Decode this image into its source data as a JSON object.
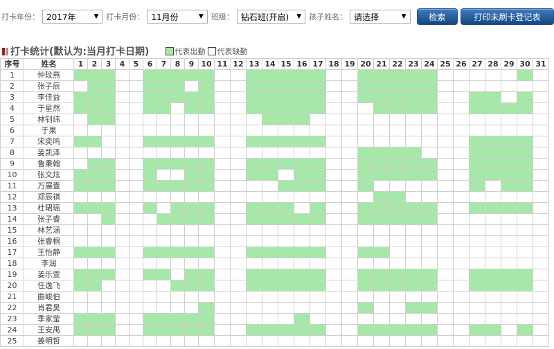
{
  "filters": {
    "year_label": "打卡年份：",
    "year_value": "2017年",
    "month_label": "打卡月份：",
    "month_value": "11月份",
    "class_label": "班级：",
    "class_value": "钻石班(开启)",
    "child_label": "孩子姓名：",
    "child_value": "请选择",
    "search_button": "检索",
    "print_button": "打印未刷卡登记表"
  },
  "section": {
    "title": "打卡统计(默认为:当月打卡日期)",
    "legend_present": "代表出勤",
    "legend_absent": "代表缺勤"
  },
  "colors": {
    "present": "#a5e8a7",
    "button": "#1f5b9f",
    "marker": "#a31b1b"
  },
  "table": {
    "col_index": "序号",
    "col_name": "姓名",
    "days": [
      "1",
      "2",
      "3",
      "4",
      "5",
      "6",
      "7",
      "8",
      "9",
      "10",
      "11",
      "12",
      "13",
      "14",
      "15",
      "16",
      "17",
      "18",
      "19",
      "20",
      "21",
      "22",
      "23",
      "24",
      "25",
      "26",
      "27",
      "28",
      "29",
      "30",
      "31"
    ],
    "rows": [
      {
        "no": "1",
        "name": "仲玟燕",
        "present": [
          1,
          2,
          3,
          6,
          7,
          8,
          9,
          10,
          13,
          14,
          15,
          16,
          17,
          20,
          21,
          22,
          23,
          24,
          30
        ]
      },
      {
        "no": "2",
        "name": "张子辰",
        "present": [
          2,
          3,
          6,
          7,
          8,
          10,
          13,
          14,
          15,
          16,
          17,
          20,
          21,
          22,
          23,
          24
        ]
      },
      {
        "no": "3",
        "name": "李佳益",
        "present": [
          1,
          2,
          3,
          6,
          7,
          8,
          9,
          10,
          13,
          14,
          15,
          16,
          17,
          20,
          21,
          22,
          23,
          24,
          27,
          28,
          30
        ]
      },
      {
        "no": "4",
        "name": "于星然",
        "present": [
          1,
          2,
          3,
          6,
          7,
          9,
          10,
          13,
          14,
          15,
          16,
          17,
          21,
          22,
          23,
          24,
          27,
          28,
          29,
          30
        ]
      },
      {
        "no": "5",
        "name": "林钊纬",
        "present": [
          2,
          3,
          14,
          15,
          16
        ]
      },
      {
        "no": "6",
        "name": "于果",
        "present": []
      },
      {
        "no": "7",
        "name": "宋奕鸣",
        "present": [
          1,
          2,
          6,
          7,
          8,
          9,
          10,
          13,
          14,
          15,
          16,
          17,
          27,
          28,
          29,
          30
        ]
      },
      {
        "no": "8",
        "name": "姜凯泽",
        "present": [
          20,
          21,
          22,
          23,
          27,
          28,
          29,
          30
        ]
      },
      {
        "no": "9",
        "name": "鲁秉翰",
        "present": [
          2,
          3,
          6,
          7,
          8,
          9,
          10,
          13,
          14,
          15,
          16,
          17,
          20,
          21,
          22,
          23,
          24,
          27,
          28,
          29,
          30
        ]
      },
      {
        "no": "10",
        "name": "张文炫",
        "present": [
          1,
          2,
          3,
          6,
          9,
          10,
          13,
          14,
          16,
          17,
          20,
          21,
          22,
          23,
          24,
          27,
          28,
          29,
          30
        ]
      },
      {
        "no": "11",
        "name": "万展壹",
        "present": [
          1,
          2,
          3,
          6,
          7,
          8,
          9,
          10,
          15,
          16,
          17,
          20,
          27,
          29,
          30
        ]
      },
      {
        "no": "12",
        "name": "郑辰祺",
        "present": [
          21,
          22
        ]
      },
      {
        "no": "13",
        "name": "杜珺瑶",
        "present": [
          1,
          2,
          3,
          6,
          8,
          9,
          10,
          13,
          14,
          15,
          17,
          20,
          21,
          22,
          23,
          24,
          27,
          28,
          29,
          30
        ]
      },
      {
        "no": "14",
        "name": "张子睿",
        "present": [
          3,
          7,
          8,
          9,
          10,
          13,
          14,
          15,
          16,
          17,
          20,
          21,
          22,
          23,
          24
        ]
      },
      {
        "no": "15",
        "name": "林艺涵",
        "present": []
      },
      {
        "no": "16",
        "name": "张睿桐",
        "present": []
      },
      {
        "no": "17",
        "name": "王怡静",
        "present": [
          1,
          2,
          3,
          6,
          7,
          8,
          9,
          10,
          13,
          14,
          15,
          16,
          17,
          20,
          21
        ]
      },
      {
        "no": "18",
        "name": "李润",
        "present": []
      },
      {
        "no": "19",
        "name": "姜乐萱",
        "present": [
          1,
          2,
          3,
          6,
          7,
          9,
          10,
          13,
          14,
          15,
          16,
          17,
          20,
          21,
          22,
          23,
          24,
          27,
          28,
          29,
          30
        ]
      },
      {
        "no": "20",
        "name": "任逸飞",
        "present": [
          1,
          2,
          8,
          9,
          10,
          13,
          14,
          15,
          16,
          17,
          20,
          21,
          22,
          23,
          24,
          27,
          28,
          29,
          30
        ]
      },
      {
        "no": "21",
        "name": "曲峻伯",
        "present": []
      },
      {
        "no": "22",
        "name": "肖君昊",
        "present": [
          10,
          20,
          23,
          24
        ]
      },
      {
        "no": "23",
        "name": "季家莹",
        "present": [
          1,
          2,
          3,
          6,
          7,
          8,
          9,
          10,
          16
        ]
      },
      {
        "no": "24",
        "name": "王安禺",
        "present": [
          1,
          2,
          3,
          6,
          7,
          8,
          9,
          10,
          13,
          14,
          15,
          16,
          17,
          20,
          21,
          22,
          23,
          24,
          27,
          28,
          30
        ]
      },
      {
        "no": "25",
        "name": "姜明哲",
        "present": []
      }
    ]
  }
}
